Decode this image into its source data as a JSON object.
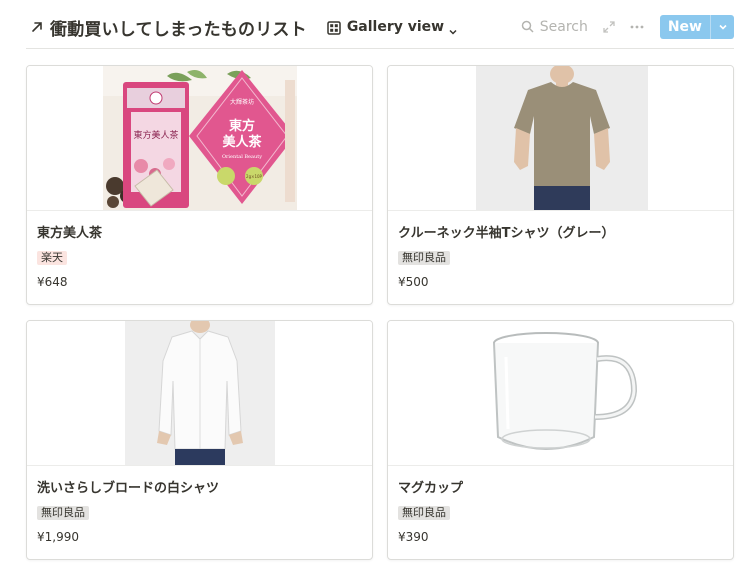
{
  "page": {
    "title": "衝動買いしてしまったものリスト",
    "view": {
      "label": "Gallery view",
      "icon": "gallery-grid-icon"
    },
    "toolbar": {
      "search_label": "Search",
      "new_label": "New"
    }
  },
  "colors": {
    "accent": "#8bc8ee",
    "tag_rakuten_bg": "#fbe4e0",
    "tag_muji_bg": "#e3e2e0",
    "text": "#37352f"
  },
  "cards": [
    {
      "title": "東方美人茶",
      "tag": "楽天",
      "price": "¥648",
      "image": "tea-package-image",
      "package_text": {
        "brand": "大輝茶坊",
        "name": "東方美人茶",
        "english": "Oriental Beauty",
        "badge": "2g×10P"
      }
    },
    {
      "title": "クルーネック半袖Tシャツ（グレー）",
      "tag": "無印良品",
      "price": "¥500",
      "image": "tshirt-image"
    },
    {
      "title": "洗いさらしブロードの白シャツ",
      "tag": "無印良品",
      "price": "¥1,990",
      "image": "white-shirt-image"
    },
    {
      "title": "マグカップ",
      "tag": "無印良品",
      "price": "¥390",
      "image": "glass-mug-image"
    }
  ]
}
